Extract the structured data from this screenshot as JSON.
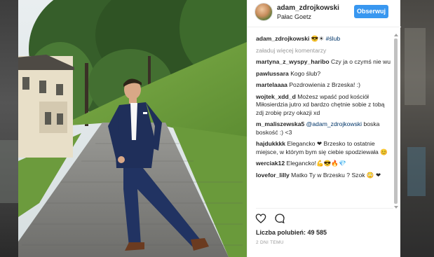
{
  "post": {
    "username": "adam_zdrojkowski",
    "location": "Pałac Goetz",
    "follow_label": "Obserwuj"
  },
  "caption": {
    "username": "adam_zdrojkowski",
    "emojis": "😎☀",
    "hashtag": "#ślub"
  },
  "load_more": "załaduj więcej komentarzy",
  "comments": [
    {
      "user": "martyna_z_wyspy_haribo",
      "text": "Czy ja o czymś nie wu"
    },
    {
      "user": "pawlussara",
      "text": "Kogo ślub?"
    },
    {
      "user": "martelaaaa",
      "text": "Pozdrowienia z Brzeska! :)"
    },
    {
      "user": "wojtek_xdd_d",
      "text": "Możesz wpaść pod kościół Miłosierdzia jutro xd bardzo chętnie sobie z tobą zdj zrobię przy okazji xd"
    },
    {
      "user": "m_maliszewska5",
      "mention": "@adam_zdrojkowski",
      "text": "boska boskość :) <3"
    },
    {
      "user": "hajdukkkk",
      "text": "Elegancko ❤ Brzesko to ostatnie miejsce, w którym bym się ciebie spodziewała 😊"
    },
    {
      "user": "werciak12",
      "text": "Elegancko!💪😎🔥💎"
    },
    {
      "user": "lovefor_lilly",
      "text": "Matko Ty w Brzesku ? Szok 😳 ❤"
    }
  ],
  "actions": {
    "like_icon": "heart-icon",
    "comment_icon": "comment-icon"
  },
  "likes_label": "Liczba polubień: 49 585",
  "timestamp": "2 DNI TEMU",
  "colors": {
    "follow_button": "#3897f0",
    "text": "#262626",
    "muted": "#999999",
    "link": "#003569"
  }
}
